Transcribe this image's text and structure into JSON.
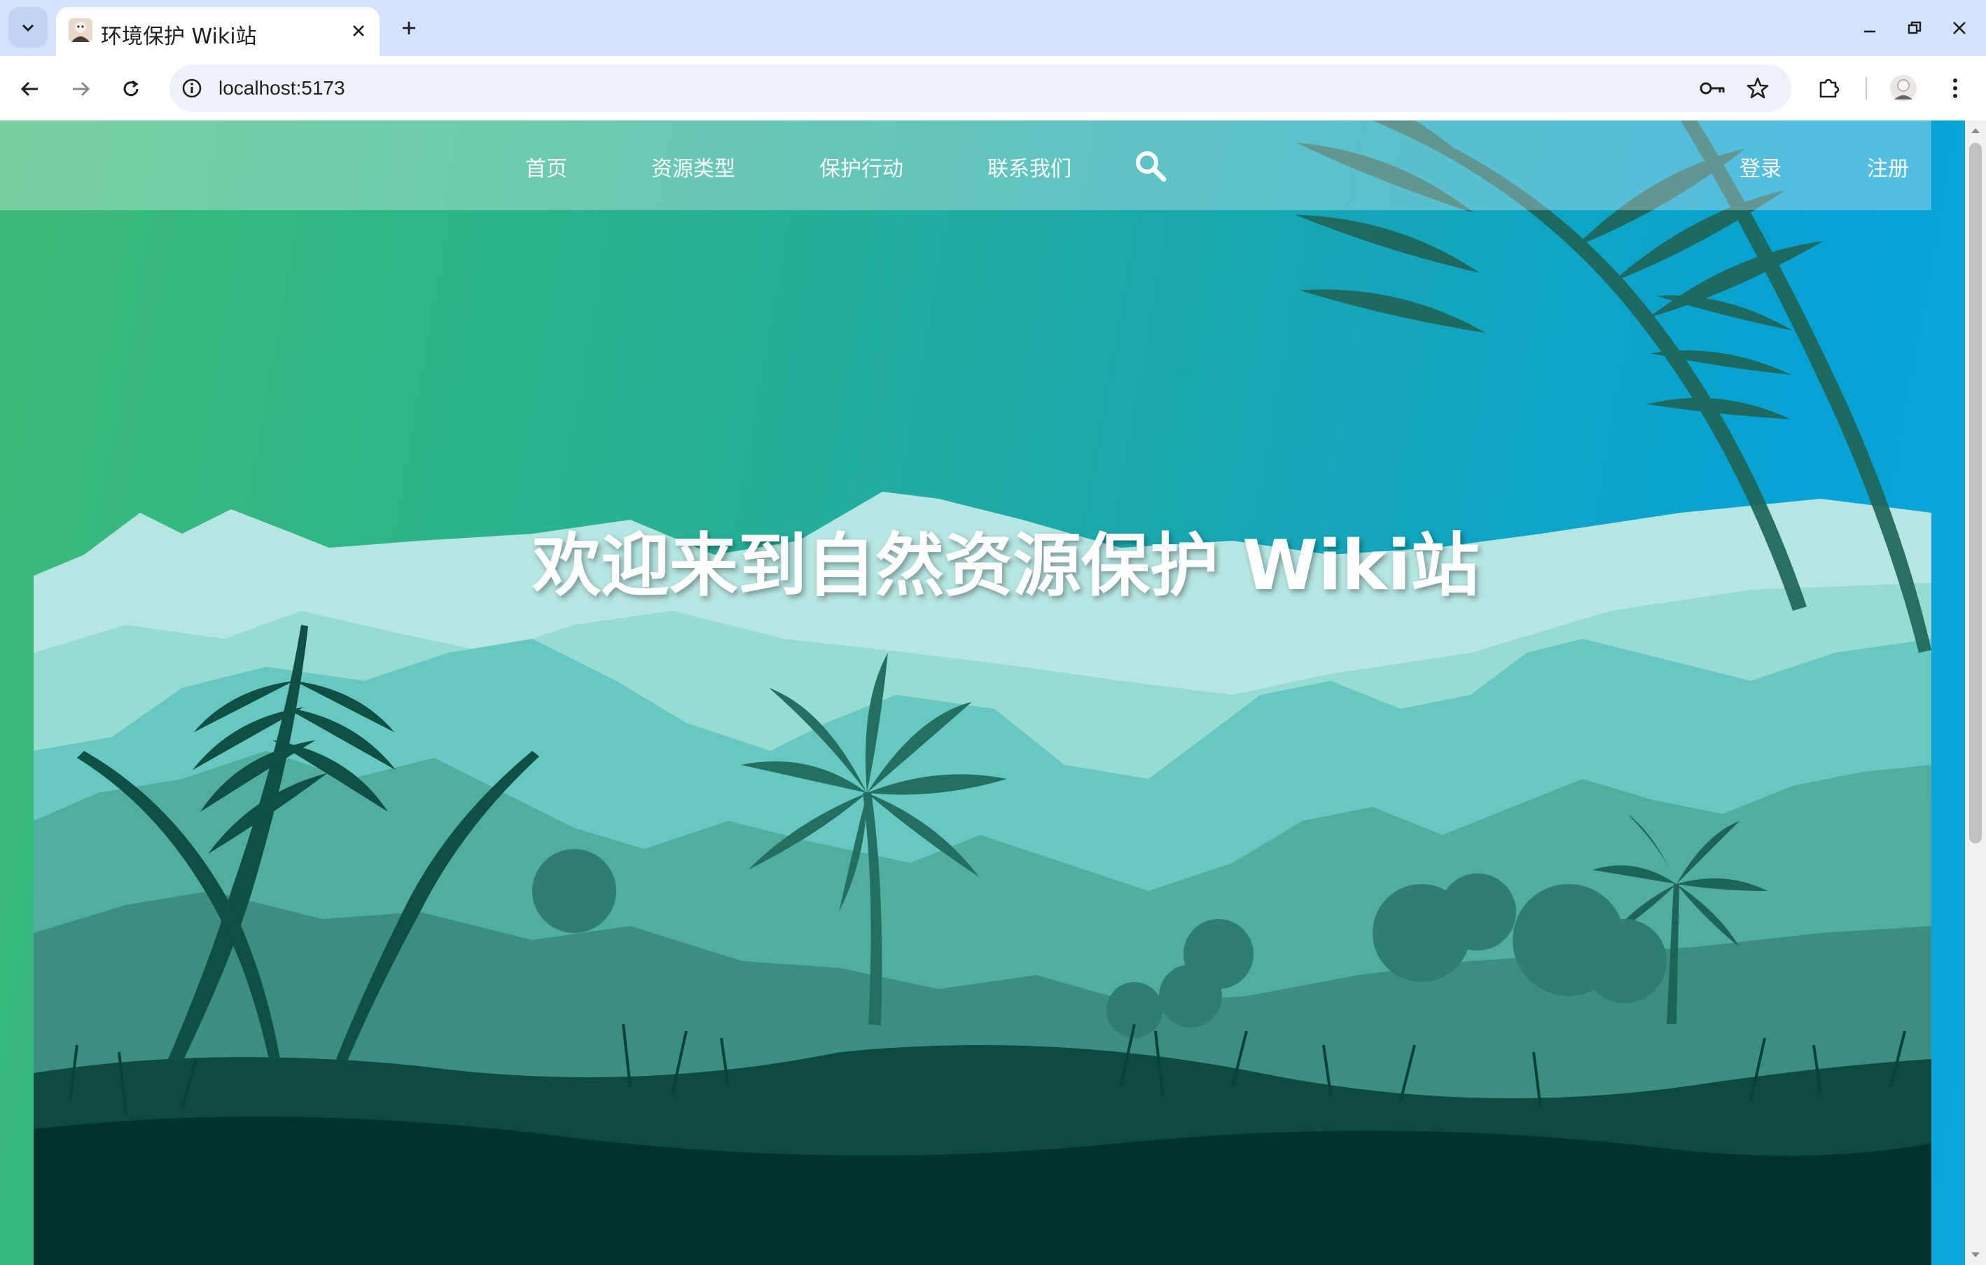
{
  "browser": {
    "tab_title": "环境保护 Wiki站",
    "url": "localhost:5173",
    "icons": {
      "tab_search": "chevron-down-icon",
      "close_tab": "close-icon",
      "new_tab": "plus-icon",
      "minimize": "minimize-icon",
      "restore": "restore-icon",
      "close_window": "close-icon",
      "back": "arrow-left-icon",
      "forward": "arrow-right-icon",
      "reload": "reload-icon",
      "site_info": "info-icon",
      "password": "key-icon",
      "bookmark": "star-icon",
      "extensions": "puzzle-icon",
      "profile": "avatar",
      "menu": "kebab-menu-icon"
    }
  },
  "site": {
    "nav": {
      "items": [
        "首页",
        "资源类型",
        "保护行动",
        "联系我们"
      ],
      "login": "登录",
      "register": "注册"
    },
    "hero": {
      "title": "欢迎来到自然资源保护 Wiki站"
    }
  },
  "colors": {
    "tabstrip": "#d3e3fd",
    "gradient_start": "#3dbb78",
    "gradient_end": "#07a2d4",
    "forest_dark": "#00332c",
    "hill_light": "#b6e6e1"
  }
}
